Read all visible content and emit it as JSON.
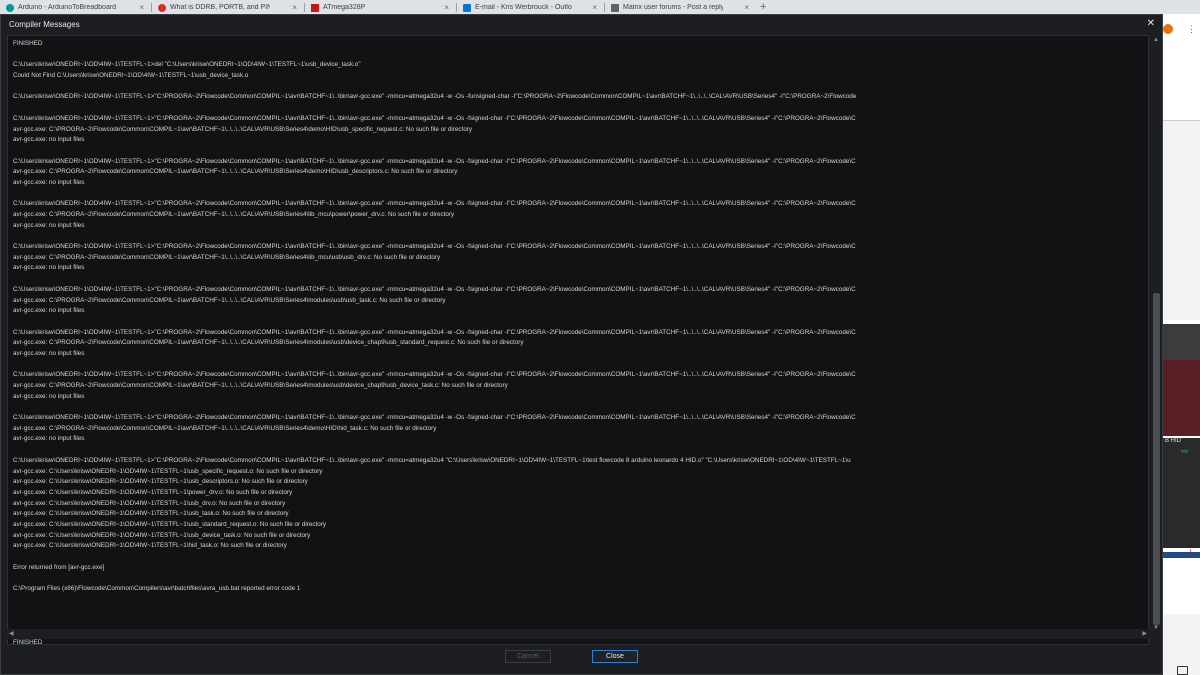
{
  "browser": {
    "tabs": [
      {
        "label": "Arduino - ArduinoToBreadboard",
        "color": "#00979c"
      },
      {
        "label": "What is DDRB, PORTB, and PINB",
        "color": "#d93025"
      },
      {
        "label": "ATmega328P",
        "color": "#c4161c"
      },
      {
        "label": "E-mail - Kris Werbrouck - Outlo",
        "color": "#0078d4"
      },
      {
        "label": "Matrix user forums - Post a reply",
        "color": "#5f6368"
      }
    ],
    "new_tab_label": "+",
    "close_tab_glyph": "×"
  },
  "background": {
    "avatar_letter": "",
    "hid_label": "B HID",
    "red_label": "-1"
  },
  "dialog": {
    "title": "Compiler Messages",
    "close_glyph": "✕",
    "log_lines": [
      "FINISHED",
      "",
      "C:\\Users\\krisw\\ONEDRI~1\\OD\\4IW~1\\TESTFL~1>del \"C:\\Users\\krisw\\ONEDRI~1\\OD\\4IW~1\\TESTFL~1\\usb_device_task.o\"",
      "Could Not Find C:\\Users\\krisw\\ONEDRI~1\\OD\\4IW~1\\TESTFL~1\\usb_device_task.o",
      "",
      "C:\\Users\\krisw\\ONEDRI~1\\OD\\4IW~1\\TESTFL~1>\"C:\\PROGRA~2\\Flowcode\\Common\\COMPIL~1\\avr\\BATCHF~1\\..\\bin\\avr-gcc.exe\" -mmcu=atmega32u4 -w -Os -funsigned-char -I\"C:\\PROGRA~2\\Flowcode\\Common\\COMPIL~1\\avr\\BATCHF~1\\..\\..\\..\\CAL\\AVR\\USB\\Series4\" -I\"C:\\PROGRA~2\\Flowcode",
      "",
      "C:\\Users\\krisw\\ONEDRI~1\\OD\\4IW~1\\TESTFL~1>\"C:\\PROGRA~2\\Flowcode\\Common\\COMPIL~1\\avr\\BATCHF~1\\..\\bin\\avr-gcc.exe\" -mmcu=atmega32u4 -w -Os -fsigned-char -I\"C:\\PROGRA~2\\Flowcode\\Common\\COMPIL~1\\avr\\BATCHF~1\\..\\..\\..\\CAL\\AVR\\USB\\Series4\" -I\"C:\\PROGRA~2\\Flowcode\\C",
      "avr-gcc.exe: C:\\PROGRA~2\\Flowcode\\Common\\COMPIL~1\\avr\\BATCHF~1\\..\\..\\..\\CAL\\AVR\\USB\\Series4\\demo\\HID\\usb_specific_request.c: No such file or directory",
      "avr-gcc.exe: no input files",
      "",
      "C:\\Users\\krisw\\ONEDRI~1\\OD\\4IW~1\\TESTFL~1>\"C:\\PROGRA~2\\Flowcode\\Common\\COMPIL~1\\avr\\BATCHF~1\\..\\bin\\avr-gcc.exe\" -mmcu=atmega32u4 -w -Os -fsigned-char -I\"C:\\PROGRA~2\\Flowcode\\Common\\COMPIL~1\\avr\\BATCHF~1\\..\\..\\..\\CAL\\AVR\\USB\\Series4\" -I\"C:\\PROGRA~2\\Flowcode\\C",
      "avr-gcc.exe: C:\\PROGRA~2\\Flowcode\\Common\\COMPIL~1\\avr\\BATCHF~1\\..\\..\\..\\CAL\\AVR\\USB\\Series4\\demo\\HID\\usb_descriptors.c: No such file or directory",
      "avr-gcc.exe: no input files",
      "",
      "C:\\Users\\krisw\\ONEDRI~1\\OD\\4IW~1\\TESTFL~1>\"C:\\PROGRA~2\\Flowcode\\Common\\COMPIL~1\\avr\\BATCHF~1\\..\\bin\\avr-gcc.exe\" -mmcu=atmega32u4 -w -Os -fsigned-char -I\"C:\\PROGRA~2\\Flowcode\\Common\\COMPIL~1\\avr\\BATCHF~1\\..\\..\\..\\CAL\\AVR\\USB\\Series4\" -I\"C:\\PROGRA~2\\Flowcode\\C",
      "avr-gcc.exe: C:\\PROGRA~2\\Flowcode\\Common\\COMPIL~1\\avr\\BATCHF~1\\..\\..\\..\\CAL\\AVR\\USB\\Series4\\lib_mcu\\power\\power_drv.c: No such file or directory",
      "avr-gcc.exe: no input files",
      "",
      "C:\\Users\\krisw\\ONEDRI~1\\OD\\4IW~1\\TESTFL~1>\"C:\\PROGRA~2\\Flowcode\\Common\\COMPIL~1\\avr\\BATCHF~1\\..\\bin\\avr-gcc.exe\" -mmcu=atmega32u4 -w -Os -fsigned-char -I\"C:\\PROGRA~2\\Flowcode\\Common\\COMPIL~1\\avr\\BATCHF~1\\..\\..\\..\\CAL\\AVR\\USB\\Series4\" -I\"C:\\PROGRA~2\\Flowcode\\C",
      "avr-gcc.exe: C:\\PROGRA~2\\Flowcode\\Common\\COMPIL~1\\avr\\BATCHF~1\\..\\..\\..\\CAL\\AVR\\USB\\Series4\\lib_mcu\\usb\\usb_drv.c: No such file or directory",
      "avr-gcc.exe: no input files",
      "",
      "C:\\Users\\krisw\\ONEDRI~1\\OD\\4IW~1\\TESTFL~1>\"C:\\PROGRA~2\\Flowcode\\Common\\COMPIL~1\\avr\\BATCHF~1\\..\\bin\\avr-gcc.exe\" -mmcu=atmega32u4 -w -Os -fsigned-char -I\"C:\\PROGRA~2\\Flowcode\\Common\\COMPIL~1\\avr\\BATCHF~1\\..\\..\\..\\CAL\\AVR\\USB\\Series4\" -I\"C:\\PROGRA~2\\Flowcode\\C",
      "avr-gcc.exe: C:\\PROGRA~2\\Flowcode\\Common\\COMPIL~1\\avr\\BATCHF~1\\..\\..\\..\\CAL\\AVR\\USB\\Series4\\modules\\usb\\usb_task.c: No such file or directory",
      "avr-gcc.exe: no input files",
      "",
      "C:\\Users\\krisw\\ONEDRI~1\\OD\\4IW~1\\TESTFL~1>\"C:\\PROGRA~2\\Flowcode\\Common\\COMPIL~1\\avr\\BATCHF~1\\..\\bin\\avr-gcc.exe\" -mmcu=atmega32u4 -w -Os -fsigned-char -I\"C:\\PROGRA~2\\Flowcode\\Common\\COMPIL~1\\avr\\BATCHF~1\\..\\..\\..\\CAL\\AVR\\USB\\Series4\" -I\"C:\\PROGRA~2\\Flowcode\\C",
      "avr-gcc.exe: C:\\PROGRA~2\\Flowcode\\Common\\COMPIL~1\\avr\\BATCHF~1\\..\\..\\..\\CAL\\AVR\\USB\\Series4\\modules\\usb\\device_chap9\\usb_standard_request.c: No such file or directory",
      "avr-gcc.exe: no input files",
      "",
      "C:\\Users\\krisw\\ONEDRI~1\\OD\\4IW~1\\TESTFL~1>\"C:\\PROGRA~2\\Flowcode\\Common\\COMPIL~1\\avr\\BATCHF~1\\..\\bin\\avr-gcc.exe\" -mmcu=atmega32u4 -w -Os -fsigned-char -I\"C:\\PROGRA~2\\Flowcode\\Common\\COMPIL~1\\avr\\BATCHF~1\\..\\..\\..\\CAL\\AVR\\USB\\Series4\" -I\"C:\\PROGRA~2\\Flowcode\\C",
      "avr-gcc.exe: C:\\PROGRA~2\\Flowcode\\Common\\COMPIL~1\\avr\\BATCHF~1\\..\\..\\..\\CAL\\AVR\\USB\\Series4\\modules\\usb\\device_chap9\\usb_device_task.c: No such file or directory",
      "avr-gcc.exe: no input files",
      "",
      "C:\\Users\\krisw\\ONEDRI~1\\OD\\4IW~1\\TESTFL~1>\"C:\\PROGRA~2\\Flowcode\\Common\\COMPIL~1\\avr\\BATCHF~1\\..\\bin\\avr-gcc.exe\" -mmcu=atmega32u4 -w -Os -fsigned-char -I\"C:\\PROGRA~2\\Flowcode\\Common\\COMPIL~1\\avr\\BATCHF~1\\..\\..\\..\\CAL\\AVR\\USB\\Series4\" -I\"C:\\PROGRA~2\\Flowcode\\C",
      "avr-gcc.exe: C:\\PROGRA~2\\Flowcode\\Common\\COMPIL~1\\avr\\BATCHF~1\\..\\..\\..\\CAL\\AVR\\USB\\Series4\\demo\\HID\\hid_task.c: No such file or directory",
      "avr-gcc.exe: no input files",
      "",
      "C:\\Users\\krisw\\ONEDRI~1\\OD\\4IW~1\\TESTFL~1>\"C:\\PROGRA~2\\Flowcode\\Common\\COMPIL~1\\avr\\BATCHF~1\\..\\bin\\avr-gcc.exe\" -mmcu=atmega32u4 \"C:\\Users\\krisw\\ONEDRI~1\\OD\\4IW~1\\TESTFL~1\\test flowcode 8 arduino leonardo 4 HID.o\" \"C:\\Users\\krisw\\ONEDRI~1\\OD\\4IW~1\\TESTFL~1\\u",
      "avr-gcc.exe: C:\\Users\\krisw\\ONEDRI~1\\OD\\4IW~1\\TESTFL~1\\usb_specific_request.o: No such file or directory",
      "avr-gcc.exe: C:\\Users\\krisw\\ONEDRI~1\\OD\\4IW~1\\TESTFL~1\\usb_descriptors.o: No such file or directory",
      "avr-gcc.exe: C:\\Users\\krisw\\ONEDRI~1\\OD\\4IW~1\\TESTFL~1\\power_drv.o: No such file or directory",
      "avr-gcc.exe: C:\\Users\\krisw\\ONEDRI~1\\OD\\4IW~1\\TESTFL~1\\usb_drv.o: No such file or directory",
      "avr-gcc.exe: C:\\Users\\krisw\\ONEDRI~1\\OD\\4IW~1\\TESTFL~1\\usb_task.o: No such file or directory",
      "avr-gcc.exe: C:\\Users\\krisw\\ONEDRI~1\\OD\\4IW~1\\TESTFL~1\\usb_standard_request.o: No such file or directory",
      "avr-gcc.exe: C:\\Users\\krisw\\ONEDRI~1\\OD\\4IW~1\\TESTFL~1\\usb_device_task.o: No such file or directory",
      "avr-gcc.exe: C:\\Users\\krisw\\ONEDRI~1\\OD\\4IW~1\\TESTFL~1\\hid_task.o: No such file or directory",
      "",
      "Error returned from [avr-gcc.exe]",
      "",
      "C:\\Program Files (x86)\\Flowcode\\Common\\Compilers\\avr\\batchfiles\\avra_usb.bat reported error code 1",
      "",
      "",
      "",
      "",
      "FINISHED"
    ],
    "buttons": {
      "cancel": "Cancel",
      "close": "Close"
    }
  }
}
